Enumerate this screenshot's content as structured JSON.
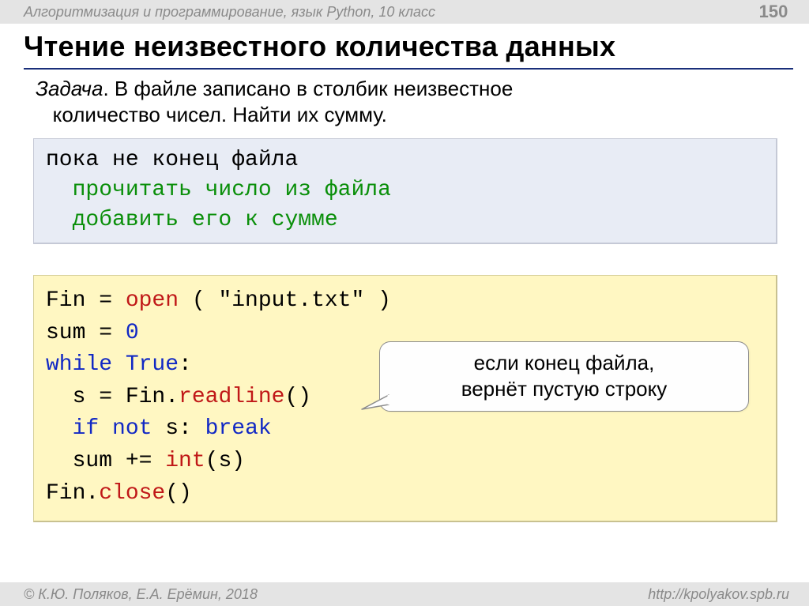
{
  "header": {
    "course": "Алгоритмизация и программирование, язык Python, 10 класс",
    "page": "150"
  },
  "title": "Чтение неизвестного количества данных",
  "task": {
    "label": "Задача",
    "text_line1": ". В файле записано в столбик неизвестное",
    "text_line2": "количество чисел. Найти их сумму."
  },
  "pseudocode": {
    "line1": "пока не конец файла",
    "line2": "  прочитать число из файла",
    "line3": "  добавить его к сумме"
  },
  "code": {
    "l1_a": "Fin = ",
    "l1_open": "open",
    "l1_b": " ( \"input.txt\" )",
    "l2_a": "sum = ",
    "l2_zero": "0",
    "l3_while": "while",
    "l3_sp": " ",
    "l3_true": "True",
    "l3_colon": ":",
    "l4_a": "  s = Fin.",
    "l4_readline": "readline",
    "l4_b": "()",
    "l5_indent": "  ",
    "l5_if": "if",
    "l5_sp1": " ",
    "l5_not": "not",
    "l5_s": " s: ",
    "l5_break": "break",
    "l6_a": "  sum += ",
    "l6_int": "int",
    "l6_b": "(s)",
    "l7_a": "Fin.",
    "l7_close": "close",
    "l7_b": "()"
  },
  "callout": {
    "line1": "если конец файла,",
    "line2": "вернёт пустую строку"
  },
  "footer": {
    "copyright": "© К.Ю. Поляков, Е.А. Ерёмин, 2018",
    "url": "http://kpolyakov.spb.ru"
  }
}
